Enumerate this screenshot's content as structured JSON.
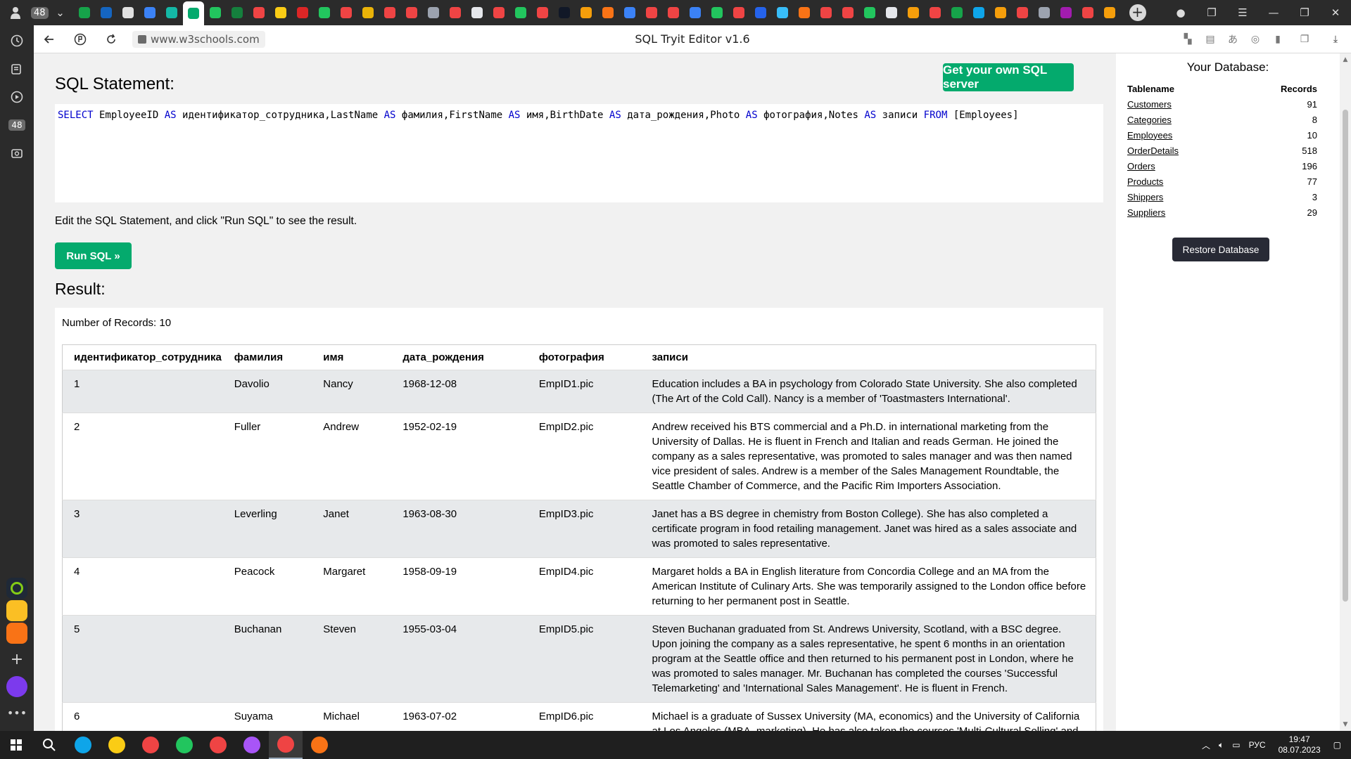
{
  "tabstrip": {
    "badge": "48",
    "tabs": [
      {
        "color": "#16a34a"
      },
      {
        "color": "#1565c0"
      },
      {
        "color": "#e0e0e0"
      },
      {
        "color": "#3b82f6"
      },
      {
        "color": "#14b8a6"
      },
      {
        "color": "#04aa6d",
        "active": true
      },
      {
        "color": "#22c55e"
      },
      {
        "color": "#15803d"
      },
      {
        "color": "#ef4444"
      },
      {
        "color": "#facc15"
      },
      {
        "color": "#dc2626"
      },
      {
        "color": "#22c55e"
      },
      {
        "color": "#ef4444"
      },
      {
        "color": "#eab308"
      },
      {
        "color": "#ef4444"
      },
      {
        "color": "#ef4444"
      },
      {
        "color": "#9ca3af"
      },
      {
        "color": "#ef4444"
      },
      {
        "color": "#e5e7eb"
      },
      {
        "color": "#ef4444"
      },
      {
        "color": "#22c55e"
      },
      {
        "color": "#ef4444"
      },
      {
        "color": "#111827"
      },
      {
        "color": "#f59e0b"
      },
      {
        "color": "#f97316"
      },
      {
        "color": "#3b82f6"
      },
      {
        "color": "#ef4444"
      },
      {
        "color": "#ef4444"
      },
      {
        "color": "#3b82f6"
      },
      {
        "color": "#22c55e"
      },
      {
        "color": "#ef4444"
      },
      {
        "color": "#2563eb"
      },
      {
        "color": "#38bdf8"
      },
      {
        "color": "#f97316"
      },
      {
        "color": "#ef4444"
      },
      {
        "color": "#ef4444"
      },
      {
        "color": "#22c55e"
      },
      {
        "color": "#e5e7eb"
      },
      {
        "color": "#f59e0b"
      },
      {
        "color": "#ef4444"
      },
      {
        "color": "#16a34a"
      },
      {
        "color": "#0ea5e9"
      },
      {
        "color": "#f59e0b"
      },
      {
        "color": "#ef4444"
      },
      {
        "color": "#9ca3af"
      },
      {
        "color": "#a21caf"
      },
      {
        "color": "#ef4444"
      },
      {
        "color": "#f59e0b"
      }
    ]
  },
  "sidebar": {
    "badge": "48"
  },
  "addressbar": {
    "url": "www.w3schools.com",
    "page_title": "SQL Tryit Editor v1.6"
  },
  "main": {
    "heading": "SQL Statement:",
    "get_server_label": "Get your own SQL server",
    "sql_tokens": [
      {
        "t": "SELECT",
        "kw": true
      },
      {
        "t": " EmployeeID "
      },
      {
        "t": "AS",
        "kw": true
      },
      {
        "t": " идентификатор_сотрудника,LastName "
      },
      {
        "t": "AS",
        "kw": true
      },
      {
        "t": " фамилия,FirstName "
      },
      {
        "t": "AS",
        "kw": true
      },
      {
        "t": " имя,BirthDate "
      },
      {
        "t": "AS",
        "kw": true
      },
      {
        "t": " дата_рождения,Photo "
      },
      {
        "t": "AS",
        "kw": true
      },
      {
        "t": " фотография,Notes "
      },
      {
        "t": "AS",
        "kw": true
      },
      {
        "t": " записи "
      },
      {
        "t": "FROM",
        "kw": true
      },
      {
        "t": " [Employees]"
      }
    ],
    "hint": "Edit the SQL Statement, and click \"Run SQL\" to see the result.",
    "run_label": "Run SQL »",
    "result_heading": "Result:",
    "record_count": "Number of Records: 10",
    "columns": [
      "идентификатор_сотрудника",
      "фамилия",
      "имя",
      "дата_рождения",
      "фотография",
      "записи"
    ],
    "rows": [
      [
        "1",
        "Davolio",
        "Nancy",
        "1968-12-08",
        "EmpID1.pic",
        "Education includes a BA in psychology from Colorado State University. She also completed (The Art of the Cold Call). Nancy is a member of 'Toastmasters International'."
      ],
      [
        "2",
        "Fuller",
        "Andrew",
        "1952-02-19",
        "EmpID2.pic",
        "Andrew received his BTS commercial and a Ph.D. in international marketing from the University of Dallas. He is fluent in French and Italian and reads German. He joined the company as a sales representative, was promoted to sales manager and was then named vice president of sales. Andrew is a member of the Sales Management Roundtable, the Seattle Chamber of Commerce, and the Pacific Rim Importers Association."
      ],
      [
        "3",
        "Leverling",
        "Janet",
        "1963-08-30",
        "EmpID3.pic",
        "Janet has a BS degree in chemistry from Boston College). She has also completed a certificate program in food retailing management. Janet was hired as a sales associate and was promoted to sales representative."
      ],
      [
        "4",
        "Peacock",
        "Margaret",
        "1958-09-19",
        "EmpID4.pic",
        "Margaret holds a BA in English literature from Concordia College and an MA from the American Institute of Culinary Arts. She was temporarily assigned to the London office before returning to her permanent post in Seattle."
      ],
      [
        "5",
        "Buchanan",
        "Steven",
        "1955-03-04",
        "EmpID5.pic",
        "Steven Buchanan graduated from St. Andrews University, Scotland, with a BSC degree. Upon joining the company as a sales representative, he spent 6 months in an orientation program at the Seattle office and then returned to his permanent post in London, where he was promoted to sales manager. Mr. Buchanan has completed the courses 'Successful Telemarketing' and 'International Sales Management'. He is fluent in French."
      ],
      [
        "6",
        "Suyama",
        "Michael",
        "1963-07-02",
        "EmpID6.pic",
        "Michael is a graduate of Sussex University (MA, economics) and the University of California at Los Angeles (MBA, marketing). He has also taken the courses 'Multi-Cultural Selling' and 'Time Management for the Sales Professional'. He is fluent in Japanese and can read and write French, Portuguese, and Spanish."
      ]
    ]
  },
  "database": {
    "title": "Your Database:",
    "col_table": "Tablename",
    "col_records": "Records",
    "tables": [
      {
        "name": "Customers",
        "records": "91"
      },
      {
        "name": "Categories",
        "records": "8"
      },
      {
        "name": "Employees",
        "records": "10"
      },
      {
        "name": "OrderDetails",
        "records": "518"
      },
      {
        "name": "Orders",
        "records": "196"
      },
      {
        "name": "Products",
        "records": "77"
      },
      {
        "name": "Shippers",
        "records": "3"
      },
      {
        "name": "Suppliers",
        "records": "29"
      }
    ],
    "restore_label": "Restore Database"
  },
  "taskbar": {
    "apps": [
      {
        "name": "edge",
        "color": "#0ea5e9"
      },
      {
        "name": "explorer",
        "color": "#facc15"
      },
      {
        "name": "opera",
        "color": "#ef4444"
      },
      {
        "name": "chrome",
        "color": "#22c55e"
      },
      {
        "name": "yandex",
        "color": "#ef4444"
      },
      {
        "name": "alice",
        "color": "#a855f7"
      },
      {
        "name": "yandex-browser",
        "color": "#ef4444",
        "active": true
      },
      {
        "name": "firefox",
        "color": "#f97316"
      }
    ],
    "lang": "РУС",
    "time": "19:47",
    "date": "08.07.2023"
  }
}
